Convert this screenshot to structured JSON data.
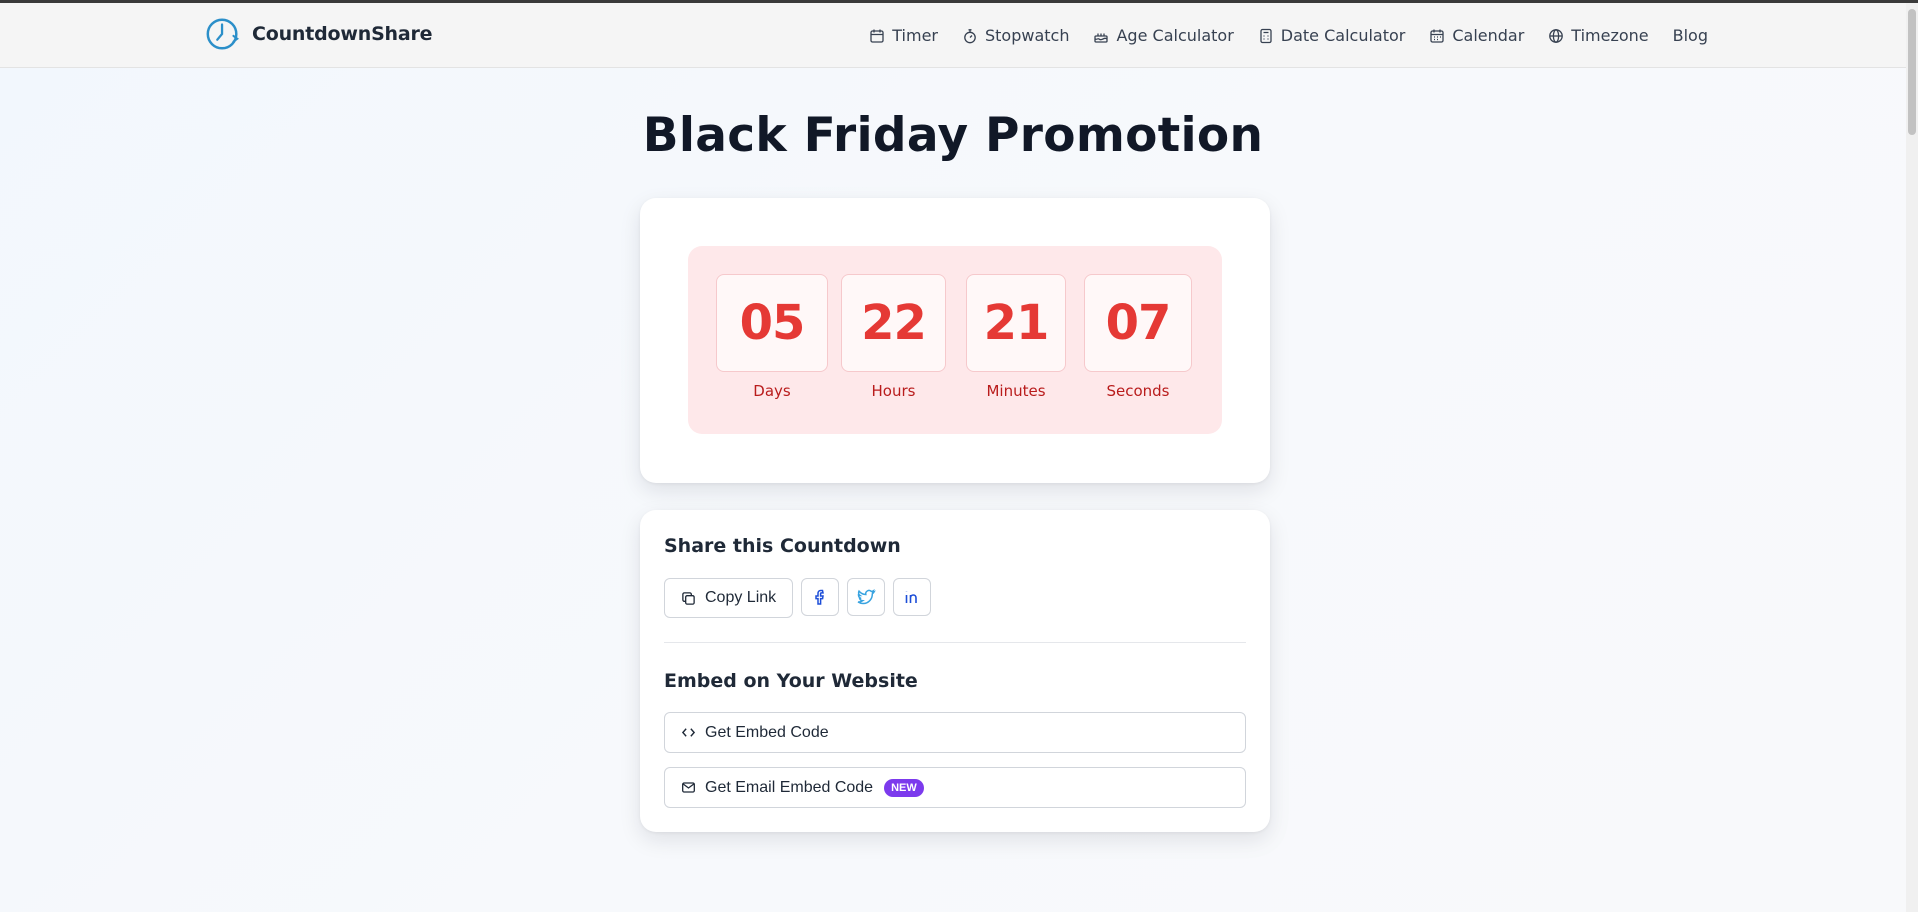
{
  "header": {
    "brand": "CountdownShare",
    "nav": [
      {
        "label": "Timer",
        "icon": "calendar-icon"
      },
      {
        "label": "Stopwatch",
        "icon": "stopwatch-icon"
      },
      {
        "label": "Age Calculator",
        "icon": "cake-icon"
      },
      {
        "label": "Date Calculator",
        "icon": "calculator-icon"
      },
      {
        "label": "Calendar",
        "icon": "calendar-grid-icon"
      },
      {
        "label": "Timezone",
        "icon": "globe-icon"
      },
      {
        "label": "Blog",
        "icon": ""
      }
    ]
  },
  "page": {
    "title": "Black Friday Promotion"
  },
  "countdown": {
    "units": [
      {
        "value": "05",
        "label": "Days"
      },
      {
        "value": "22",
        "label": "Hours"
      },
      {
        "value": "21",
        "label": "Minutes"
      },
      {
        "value": "07",
        "label": "Seconds"
      }
    ]
  },
  "share": {
    "title": "Share this Countdown",
    "copy_link_label": "Copy Link",
    "social": [
      "facebook-icon",
      "twitter-icon",
      "linkedin-icon"
    ]
  },
  "embed": {
    "title": "Embed on Your Website",
    "embed_code_label": "Get Embed Code",
    "email_embed_label": "Get Email Embed Code",
    "new_badge": "NEW"
  },
  "colors": {
    "accent_red": "#e53935",
    "timer_bg": "#fee8ea",
    "brand_blue": "#2b8fc9",
    "badge_purple": "#7c3aed"
  }
}
